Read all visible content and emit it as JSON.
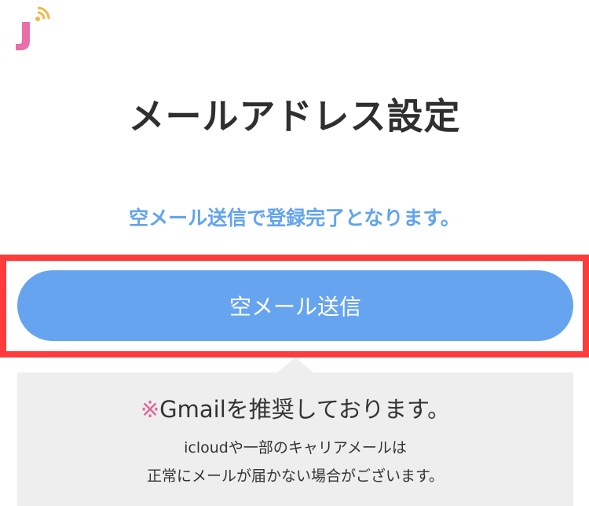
{
  "logo": {
    "icon": "signal-j-logo",
    "colors": {
      "letter": "#e870a8",
      "signal": "#f2b84b"
    }
  },
  "title": "メールアドレス設定",
  "subtitle": "空メール送信で登録完了となります。",
  "send_button": {
    "label": "空メール送信",
    "color": "#67a4ef"
  },
  "highlight_color": "#ff3b3b",
  "notice": {
    "mark": "※",
    "headline": "Gmailを推奨しております。",
    "lines": [
      "icloudや一部のキャリアメールは",
      "正常にメールが届かない場合がございます。"
    ]
  }
}
